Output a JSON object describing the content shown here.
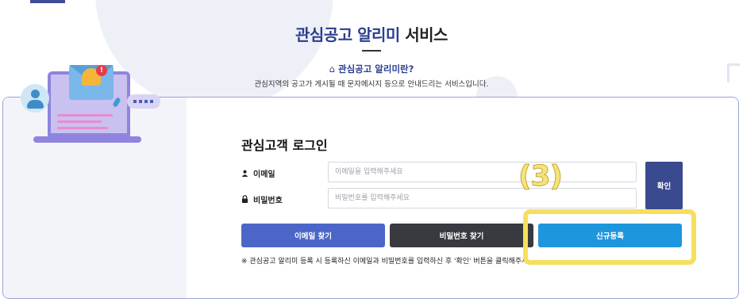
{
  "header": {
    "title_highlight": "관심공고 알리미",
    "title_rest": " 서비스",
    "subtitle_icon": "home-icon",
    "subtitle": "관심공고 알리미란?",
    "description": "관심지역의 공고가 게시될 때 문자메시지 등으로 안내드리는 서비스입니다."
  },
  "login": {
    "title": "관심고객 로그인",
    "email_label": "이메일",
    "email_icon": "person-icon",
    "email_placeholder": "이메일을 입력해주세요",
    "email_value": "",
    "password_label": "비밀번호",
    "password_icon": "lock-icon",
    "password_placeholder": "비밀번호를 입력해주세요",
    "password_value": "",
    "confirm_label": "확인",
    "find_email_label": "이메일 찾기",
    "find_password_label": "비밀번호 찾기",
    "signup_label": "신규등록",
    "notice": "※ 관심공고 알리미 등록 시 등록하신 이메일과 비밀번호를 입력하신 후 '확인' 버튼을 클릭해주세..."
  },
  "illustration": {
    "badge_text": "!"
  },
  "annotation": {
    "label": "(3)",
    "color": "#f6df5e"
  },
  "colors": {
    "brand_navy": "#2a3f8f",
    "confirm_button": "#3a4a8e",
    "find_email_button": "#4c66c8",
    "find_password_button": "#383a40",
    "signup_button": "#1e96dd"
  }
}
